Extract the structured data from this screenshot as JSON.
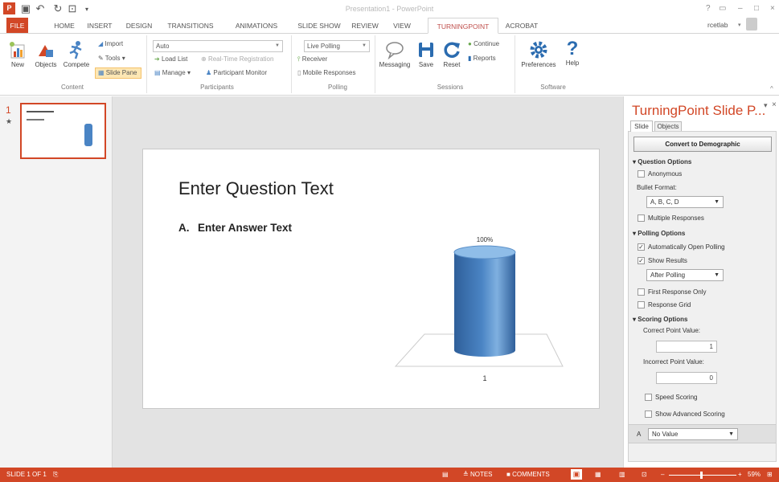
{
  "title": "Presentation1 - PowerPoint",
  "window": {
    "help": "?",
    "user": "rcetlab"
  },
  "tabs": [
    "FILE",
    "HOME",
    "INSERT",
    "DESIGN",
    "TRANSITIONS",
    "ANIMATIONS",
    "SLIDE SHOW",
    "REVIEW",
    "VIEW",
    "TURNINGPOINT",
    "ACROBAT"
  ],
  "ribbon": {
    "content": {
      "label": "Content",
      "new": "New",
      "objects": "Objects",
      "compete": "Compete",
      "import": "Import",
      "tools": "Tools",
      "slide_pane": "Slide Pane"
    },
    "participants": {
      "label": "Participants",
      "select": "Auto",
      "load_list": "Load List",
      "realtime": "Real-Time Registration",
      "manage": "Manage",
      "monitor": "Participant Monitor"
    },
    "polling": {
      "label": "Polling",
      "select": "Live Polling",
      "receiver": "Receiver",
      "mobile": "Mobile Responses"
    },
    "sessions": {
      "label": "Sessions",
      "messaging": "Messaging",
      "save": "Save",
      "reset": "Reset",
      "continue": "Continue",
      "reports": "Reports"
    },
    "software": {
      "label": "Software",
      "preferences": "Preferences",
      "help": "Help"
    }
  },
  "thumb": {
    "number": "1"
  },
  "slide": {
    "question": "Enter Question Text",
    "answer_letter": "A.",
    "answer": "Enter Answer Text",
    "bar_label": "100%",
    "x_label": "1"
  },
  "chart_data": {
    "type": "bar",
    "categories": [
      "1"
    ],
    "values": [
      100
    ],
    "data_labels": [
      "100%"
    ],
    "ylim": [
      0,
      100
    ]
  },
  "pane": {
    "title": "TurningPoint Slide P...",
    "tabs": [
      "Slide",
      "Objects"
    ],
    "convert": "Convert to Demographic",
    "question_options": "Question Options",
    "anonymous": "Anonymous",
    "bullet_format_label": "Bullet Format:",
    "bullet_format": "A, B, C, D",
    "multiple": "Multiple Responses",
    "polling_options": "Polling Options",
    "auto_open": "Automatically Open Polling",
    "show_results": "Show Results",
    "after_polling": "After Polling",
    "first_response": "First Response Only",
    "response_grid": "Response Grid",
    "scoring_options": "Scoring Options",
    "correct_label": "Correct Point Value:",
    "correct_value": "1",
    "incorrect_label": "Incorrect Point Value:",
    "incorrect_value": "0",
    "speed": "Speed Scoring",
    "advanced": "Show Advanced Scoring",
    "answer_letter": "A",
    "answer_value": "No Value"
  },
  "status": {
    "slide": "SLIDE 1 OF 1",
    "notes": "NOTES",
    "comments": "COMMENTS",
    "zoom": "59%"
  },
  "colors": {
    "accent": "#d24726",
    "bar": "#4a84c4"
  }
}
